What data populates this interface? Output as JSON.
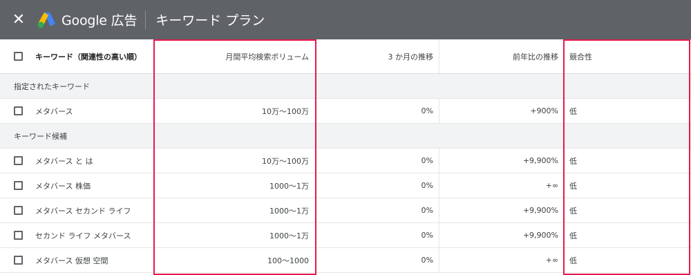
{
  "topbar": {
    "close_icon": "close-icon",
    "logo_icon": "google-ads-logo-icon",
    "brand": "Google 広告",
    "title": "キーワード プラン"
  },
  "columns": {
    "keyword": "キーワード（関連性の高い順）",
    "volume": "月間平均検索ボリューム",
    "three_month": "3 か月の推移",
    "yoy": "前年比の推移",
    "competition": "競合性"
  },
  "groups": [
    {
      "label": "指定されたキーワード",
      "rows": [
        {
          "keyword": "メタバース",
          "volume": "10万～100万",
          "three_month": "0%",
          "yoy": "+900%",
          "competition": "低"
        }
      ]
    },
    {
      "label": "キーワード候補",
      "rows": [
        {
          "keyword": "メタバース と は",
          "volume": "10万～100万",
          "three_month": "0%",
          "yoy": "+9,900%",
          "competition": "低"
        },
        {
          "keyword": "メタバース 株価",
          "volume": "1000～1万",
          "three_month": "0%",
          "yoy": "+∞",
          "competition": "低"
        },
        {
          "keyword": "メタバース セカンド ライフ",
          "volume": "1000～1万",
          "three_month": "0%",
          "yoy": "+9,900%",
          "competition": "低"
        },
        {
          "keyword": "セカンド ライフ メタバース",
          "volume": "1000～1万",
          "three_month": "0%",
          "yoy": "+9,900%",
          "competition": "低"
        },
        {
          "keyword": "メタバース 仮想 空間",
          "volume": "100～1000",
          "three_month": "0%",
          "yoy": "+∞",
          "competition": "低"
        }
      ]
    }
  ],
  "colors": {
    "topbar": "#5f6368",
    "highlight": "#e8184d",
    "google_blue": "#4285f4",
    "google_yellow": "#fbbc04",
    "google_green": "#34a853"
  }
}
